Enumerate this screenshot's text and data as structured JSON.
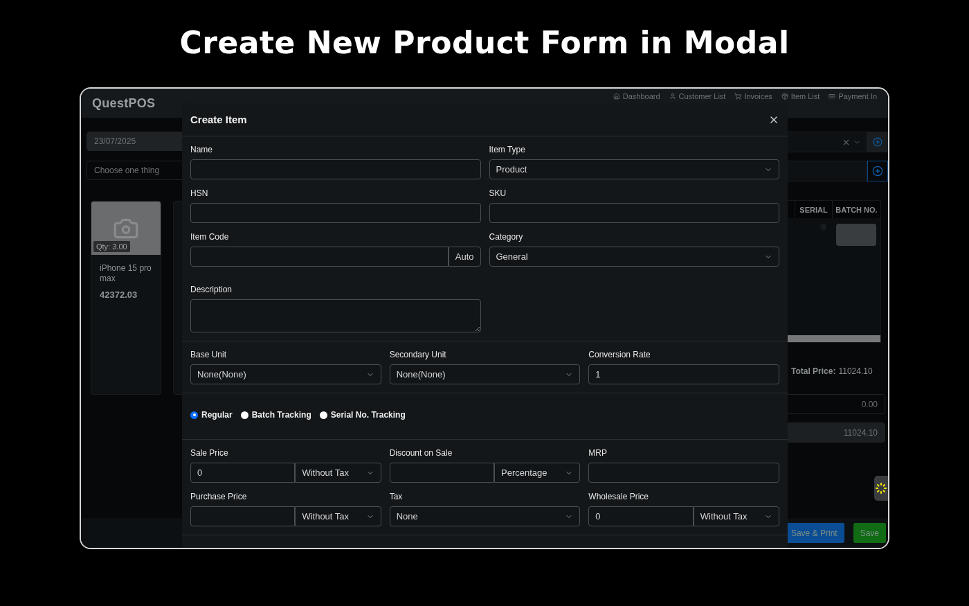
{
  "page_title": "Create New Product Form in Modal",
  "app": {
    "brand": "QuestPOS",
    "nav": [
      {
        "label": "Dashboard"
      },
      {
        "label": "Customer List"
      },
      {
        "label": "Invoices"
      },
      {
        "label": "Item List"
      },
      {
        "label": "Payment In"
      }
    ],
    "date_field": {
      "value": "23/07/2025"
    },
    "search_field": {
      "placeholder": "Choose one thing"
    },
    "product_card": {
      "qty": "Qty: 3.00",
      "name": "iPhone 15 pro max",
      "price": "42372.03"
    },
    "table": {
      "columns": [
        "SERIAL",
        "BATCH NO."
      ]
    },
    "total": {
      "label": "Total Price:",
      "value": "11024.10"
    },
    "discount_field": {
      "value": "0.00"
    },
    "grand_total_field": {
      "value": "11024.10"
    },
    "buttons": [
      {
        "label": "Save & Print",
        "kind": "primary"
      },
      {
        "label": "Save",
        "kind": "success"
      }
    ]
  },
  "modal": {
    "title": "Create Item",
    "sections": [
      {
        "kind": "fields",
        "rows": [
          {
            "kind": "pair",
            "fields": [
              {
                "kind": "text",
                "label": "Name"
              },
              {
                "kind": "select",
                "label": "Item Type",
                "value": "Product"
              }
            ]
          },
          {
            "kind": "pair",
            "fields": [
              {
                "kind": "text",
                "label": "HSN"
              },
              {
                "kind": "text",
                "label": "SKU"
              }
            ]
          },
          {
            "kind": "pair",
            "fields": [
              {
                "kind": "addon",
                "label": "Item Code",
                "addon": "Auto"
              },
              {
                "kind": "select",
                "label": "Category",
                "value": "General"
              }
            ]
          },
          {
            "kind": "pair",
            "fields": [
              {
                "kind": "textarea",
                "label": "Description"
              }
            ]
          }
        ]
      },
      {
        "kind": "fields",
        "rows": [
          {
            "kind": "triple",
            "fields": [
              {
                "kind": "select",
                "label": "Base Unit",
                "value": "None(None)"
              },
              {
                "kind": "select",
                "label": "Secondary Unit",
                "value": "None(None)"
              },
              {
                "kind": "text",
                "label": "Conversion Rate",
                "value": "1"
              }
            ]
          }
        ]
      },
      {
        "kind": "radios",
        "options": [
          {
            "label": "Regular",
            "selected": true
          },
          {
            "label": "Batch Tracking",
            "selected": false
          },
          {
            "label": "Serial No. Tracking",
            "selected": false
          }
        ]
      },
      {
        "kind": "fields",
        "rows": [
          {
            "kind": "triple",
            "fields": [
              {
                "kind": "combo",
                "label": "Sale Price",
                "value": "0",
                "option": "Without Tax"
              },
              {
                "kind": "combo",
                "label": "Discount on Sale",
                "option": "Percentage"
              },
              {
                "kind": "text",
                "label": "MRP"
              }
            ]
          },
          {
            "kind": "triple",
            "fields": [
              {
                "kind": "combo",
                "label": "Purchase Price",
                "option": "Without Tax"
              },
              {
                "kind": "select",
                "label": "Tax",
                "value": "None"
              },
              {
                "kind": "combo",
                "label": "Wholesale Price",
                "value": "0",
                "option": "Without Tax"
              }
            ]
          }
        ]
      }
    ]
  }
}
